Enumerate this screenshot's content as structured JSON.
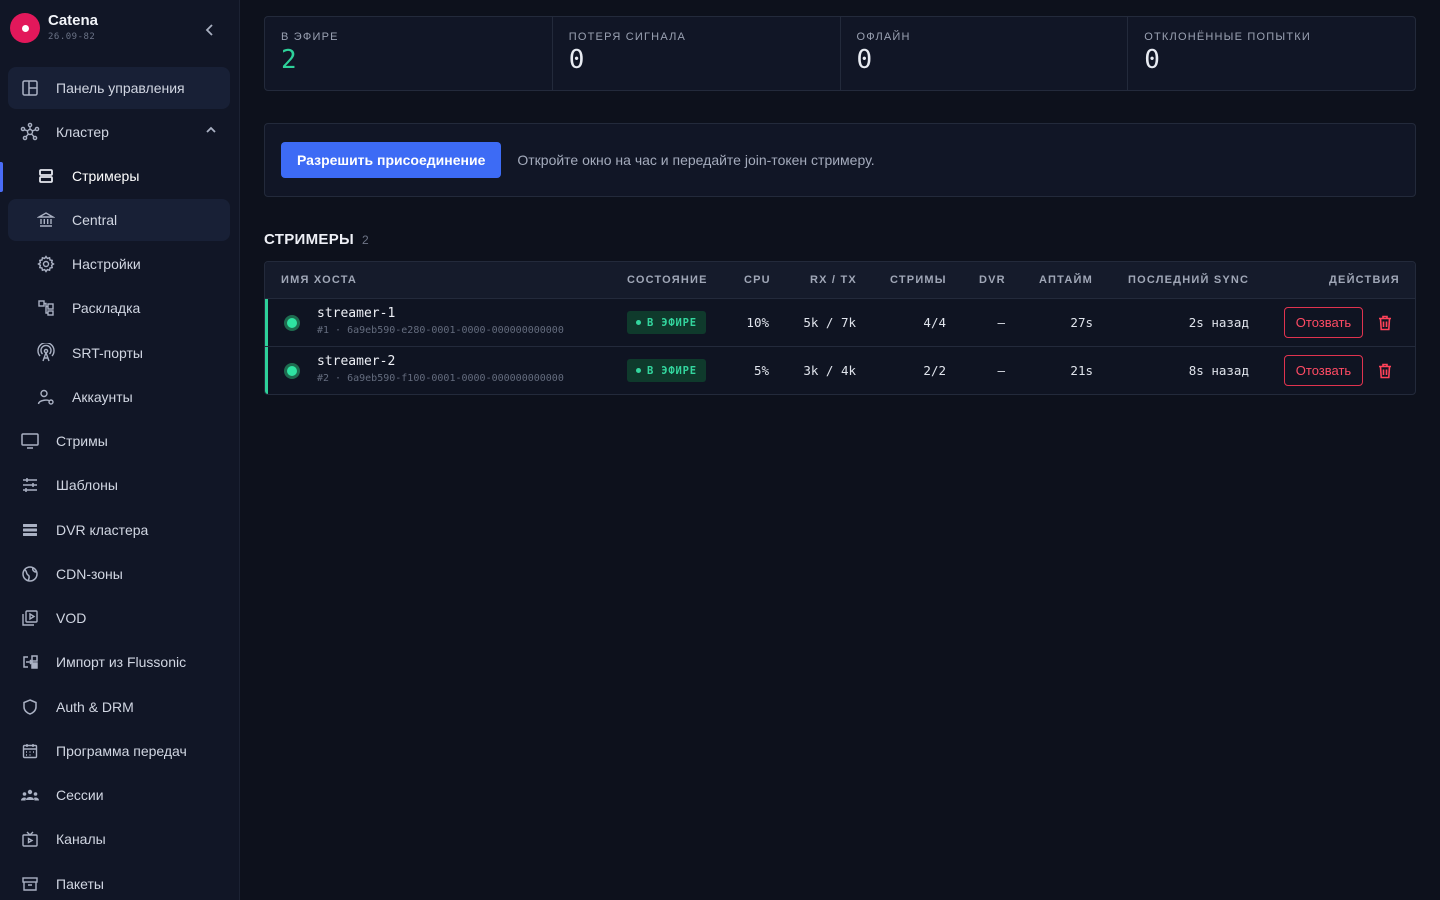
{
  "app": {
    "name": "Catena",
    "version": "26.09-82"
  },
  "sidebar": {
    "items": [
      {
        "label": "Панель управления",
        "icon": "dashboard-icon"
      },
      {
        "label": "Кластер",
        "icon": "cluster-icon"
      },
      {
        "label": "Стримеры",
        "icon": "server-icon"
      },
      {
        "label": "Central",
        "icon": "bank-icon"
      },
      {
        "label": "Настройки",
        "icon": "gear-icon"
      },
      {
        "label": "Раскладка",
        "icon": "layout-icon"
      },
      {
        "label": "SRT-порты",
        "icon": "antenna-icon"
      },
      {
        "label": "Аккаунты",
        "icon": "user-cog-icon"
      },
      {
        "label": "Стримы",
        "icon": "monitor-icon"
      },
      {
        "label": "Шаблоны",
        "icon": "sliders-icon"
      },
      {
        "label": "DVR кластера",
        "icon": "storage-icon"
      },
      {
        "label": "CDN-зоны",
        "icon": "globe-icon"
      },
      {
        "label": "VOD",
        "icon": "video-library-icon"
      },
      {
        "label": "Импорт из Flussonic",
        "icon": "import-icon"
      },
      {
        "label": "Auth & DRM",
        "icon": "shield-icon"
      },
      {
        "label": "Программа передач",
        "icon": "calendar-icon"
      },
      {
        "label": "Сессии",
        "icon": "users-icon"
      },
      {
        "label": "Каналы",
        "icon": "tv-icon"
      },
      {
        "label": "Пакеты",
        "icon": "archive-icon"
      }
    ]
  },
  "stats": [
    {
      "label": "В ЭФИРЕ",
      "value": "2"
    },
    {
      "label": "ПОТЕРЯ СИГНАЛА",
      "value": "0"
    },
    {
      "label": "ОФЛАЙН",
      "value": "0"
    },
    {
      "label": "ОТКЛОНЁННЫЕ ПОПЫТКИ",
      "value": "0"
    }
  ],
  "join": {
    "button": "Разрешить присоединение",
    "hint": "Откройте окно на час и передайте join-токен стримеру."
  },
  "streamers": {
    "title": "СТРИМЕРЫ",
    "count": "2",
    "columns": [
      "ИМЯ ХОСТА",
      "СОСТОЯНИЕ",
      "CPU",
      "RX / TX",
      "СТРИМЫ",
      "DVR",
      "АПТАЙМ",
      "ПОСЛЕДНИЙ SYNC",
      "ДЕЙСТВИЯ"
    ],
    "rows": [
      {
        "host": "streamer-1",
        "sub": "#1 · 6a9eb590-e280-0001-0000-000000000000",
        "state": "В ЭФИРЕ",
        "cpu": "10%",
        "rxtx": "5k / 7k",
        "streams": "4/4",
        "dvr": "—",
        "uptime": "27s",
        "sync": "2s назад",
        "revoke": "Отозвать"
      },
      {
        "host": "streamer-2",
        "sub": "#2 · 6a9eb590-f100-0001-0000-000000000000",
        "state": "В ЭФИРЕ",
        "cpu": "5%",
        "rxtx": "3k / 4k",
        "streams": "2/2",
        "dvr": "—",
        "uptime": "21s",
        "sync": "8s назад",
        "revoke": "Отозвать"
      }
    ]
  },
  "colors": {
    "accent": "#3d6bf5",
    "live": "#2ed19a",
    "danger": "#ff4b64",
    "brand": "#e2185b"
  }
}
